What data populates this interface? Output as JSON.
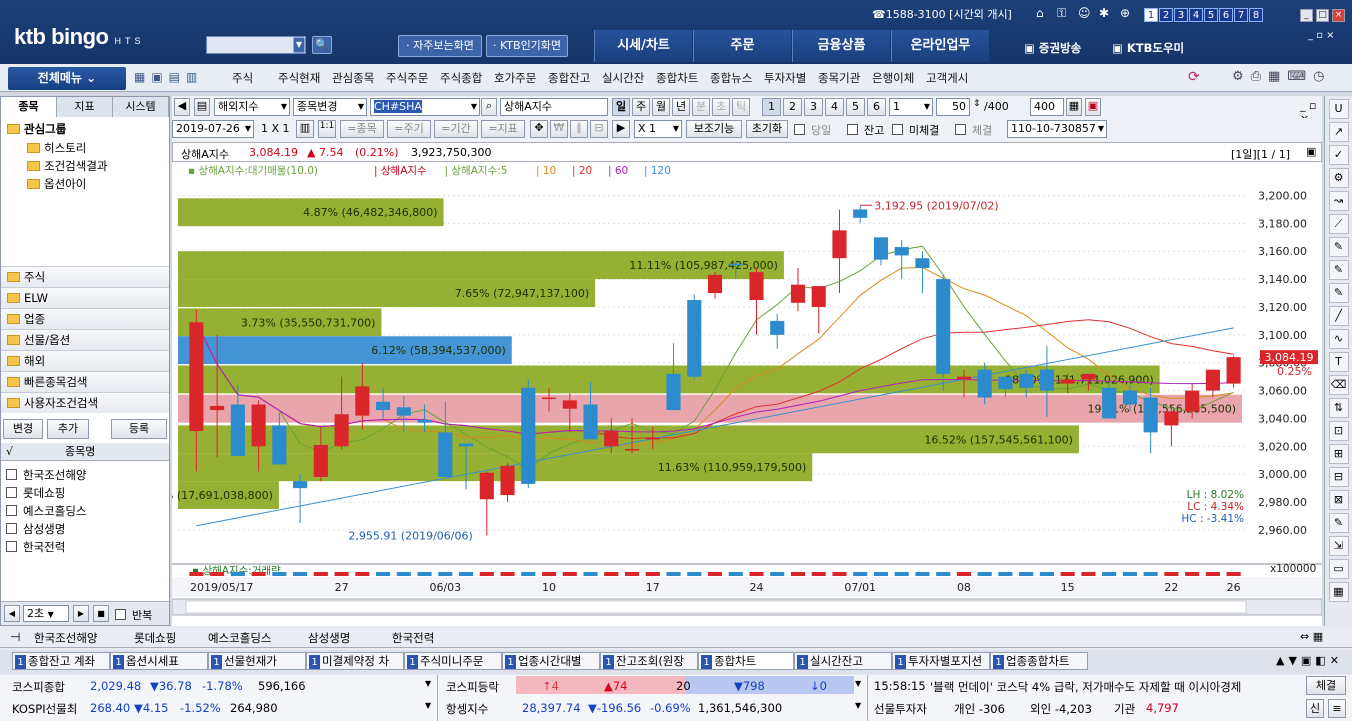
{
  "top": {
    "logo": "ktb bingo",
    "logo_sub": "HTS",
    "phone": "☎1588-3100",
    "status": "[시간외 개시]",
    "num_tabs": [
      "1",
      "2",
      "3",
      "4",
      "5",
      "6",
      "7",
      "8"
    ],
    "quick": [
      "자주보는화면",
      "KTB인기화면"
    ],
    "tabs": [
      "시세/차트",
      "주문",
      "금융상품",
      "온라인업무"
    ],
    "broadcast": "증권방송",
    "help": "KTB도우미"
  },
  "menu": {
    "all": "전체메뉴",
    "items": [
      "주식",
      "주식현재",
      "관심종목",
      "주식주문",
      "주식종합",
      "호가주문",
      "종합잔고",
      "실시간잔",
      "종합차트",
      "종합뉴스",
      "투자자별",
      "종목기관",
      "은행이체",
      "고객게시"
    ]
  },
  "left": {
    "tabs": [
      "종목",
      "지표",
      "시스템"
    ],
    "group": "관심그룹",
    "tree": [
      "히스토리",
      "조건검색결과",
      "옵션아이"
    ],
    "cats": [
      "주식",
      "ELW",
      "업종",
      "선물/옵션",
      "해외",
      "빠른종목검색",
      "사용자조건검색"
    ],
    "buttons": [
      "변경",
      "추가",
      "등록"
    ],
    "col": "종목명",
    "check_head": "√",
    "stocks": [
      "한국조선해양",
      "롯데쇼핑",
      "예스코홀딩스",
      "삼성생명",
      "한국전력"
    ],
    "interval": "2초",
    "repeat": "반복"
  },
  "toolbar": {
    "market": "해외지수",
    "change": "종목변경",
    "code": "CH#SHA",
    "name": "상해A지수",
    "periods": [
      "일",
      "주",
      "월",
      "년",
      "분",
      "초",
      "틱"
    ],
    "nums": [
      "1",
      "2",
      "3",
      "4",
      "5",
      "6"
    ],
    "n1": "1",
    "count": "50",
    "total": "/400",
    "total2": "400",
    "date": "2019-07-26",
    "scale": "1 X 1",
    "btns": [
      "=종목",
      "=주기",
      "=기간",
      "=지표"
    ],
    "mult": "X  1",
    "aux": "보조기능",
    "init": "초기화",
    "checks": [
      "당일",
      "잔고",
      "미체결",
      "체결"
    ],
    "account": "110-10-730857"
  },
  "chart_info": {
    "name": "상해A지수",
    "price": "3,084.19",
    "change": "▲ 7.54",
    "rate": "(0.21%)",
    "volume": "3,923,750,300",
    "page": "[1일][1 / 1]",
    "legend": [
      "상해A지수:대기매물(10.0)",
      "상해A지수",
      "상해A지수:5",
      "10",
      "20",
      "60",
      "120"
    ],
    "legend_colors": [
      "#6aa33a",
      "#d0021b",
      "#6aa33a",
      "#d88a1c",
      "#e03030",
      "#b020c0",
      "#3a8fd0"
    ],
    "vol_legend": "상해A지수:거래량",
    "vol_unit": "x100000"
  },
  "chart_data": {
    "type": "candlestick",
    "x": [
      "2019/05/17",
      "27",
      "06/03",
      "10",
      "17",
      "24",
      "07/01",
      "08",
      "15",
      "22",
      "26"
    ],
    "y_ticks": [
      3200,
      3180,
      3160,
      3140,
      3120,
      3100,
      3080,
      3060,
      3040,
      3020,
      3000,
      2980,
      2960
    ],
    "ylim": [
      2942,
      3214
    ],
    "ohlc": [
      [
        3031,
        3118,
        3002,
        3109
      ],
      [
        3046,
        3100,
        3012,
        3049
      ],
      [
        3050,
        3064,
        3016,
        3013
      ],
      [
        3020,
        3053,
        3002,
        3050
      ],
      [
        3035,
        3044,
        3027,
        3007
      ],
      [
        2995,
        3000,
        2965,
        2990
      ],
      [
        2998,
        3034,
        2995,
        3021
      ],
      [
        3020,
        3070,
        3018,
        3043
      ],
      [
        3042,
        3080,
        3032,
        3063
      ],
      [
        3052,
        3062,
        3040,
        3046
      ],
      [
        3048,
        3056,
        3030,
        3042
      ],
      [
        3039,
        3050,
        3030,
        3037
      ],
      [
        3030,
        3052,
        3024,
        2998
      ],
      [
        3022,
        3021,
        2989,
        3020
      ],
      [
        2982,
        3002,
        2956,
        3001
      ],
      [
        2985,
        3008,
        2980,
        3006
      ],
      [
        3062,
        3068,
        2990,
        2993
      ],
      [
        3055,
        3062,
        3045,
        3055
      ],
      [
        3047,
        3058,
        3030,
        3053
      ],
      [
        3050,
        3066,
        3032,
        3025
      ],
      [
        3020,
        3040,
        3015,
        3031
      ],
      [
        3018,
        3040,
        3015,
        3018
      ],
      [
        3026,
        3034,
        3018,
        3026
      ],
      [
        3072,
        3094,
        3060,
        3046
      ],
      [
        3125,
        3129,
        3068,
        3070
      ],
      [
        3130,
        3145,
        3126,
        3143
      ],
      [
        3151,
        3152,
        3140,
        3150
      ],
      [
        3125,
        3148,
        3100,
        3145
      ],
      [
        3110,
        3115,
        3090,
        3100
      ],
      [
        3123,
        3148,
        3117,
        3136
      ],
      [
        3120,
        3130,
        3101,
        3135
      ],
      [
        3155,
        3190,
        3130,
        3175
      ],
      [
        3190,
        3193,
        3180,
        3184
      ],
      [
        3170,
        3168,
        3150,
        3154
      ],
      [
        3163,
        3168,
        3140,
        3157
      ],
      [
        3155,
        3160,
        3130,
        3148
      ],
      [
        3140,
        3143,
        3060,
        3072
      ],
      [
        3068,
        3075,
        3055,
        3070
      ],
      [
        3075,
        3080,
        3050,
        3055
      ],
      [
        3070,
        3068,
        3055,
        3061
      ],
      [
        3072,
        3075,
        3055,
        3062
      ],
      [
        3075,
        3092,
        3041,
        3060
      ],
      [
        3065,
        3072,
        3058,
        3068
      ],
      [
        3068,
        3070,
        3060,
        3072
      ],
      [
        3062,
        3066,
        3048,
        3040
      ],
      [
        3060,
        3064,
        3045,
        3050
      ],
      [
        3055,
        3062,
        3015,
        3030
      ],
      [
        3035,
        3050,
        3020,
        3045
      ],
      [
        3045,
        3065,
        3040,
        3060
      ],
      [
        3060,
        3072,
        3055,
        3075
      ],
      [
        3065,
        3085,
        3062,
        3084
      ]
    ],
    "supply_bars": [
      {
        "label": "4.87% (46,482,346,800)",
        "pct": 4.87,
        "range": [
          3178,
          3198
        ]
      },
      {
        "label": "11.11% (105,987,425,000)",
        "pct": 11.11,
        "range": [
          3140,
          3160
        ]
      },
      {
        "label": "7.65% (72,947,137,100)",
        "pct": 7.65,
        "range": [
          3120,
          3140
        ]
      },
      {
        "label": "3.73% (35,550,731,700)",
        "pct": 3.73,
        "range": [
          3099,
          3119
        ]
      },
      {
        "label": "6.12% (58,394,537,000)",
        "pct": 6.12,
        "range": [
          3079,
          3099
        ]
      },
      {
        "label": "18.00% (171,711,026,900)",
        "pct": 18.0,
        "range": [
          3058,
          3078
        ]
      },
      {
        "label": "19.51% (186,556,285,500)",
        "pct": 19.51,
        "range": [
          3037,
          3057
        ]
      },
      {
        "label": "16.52% (157,545,561,100)",
        "pct": 16.52,
        "range": [
          3015,
          3035
        ]
      },
      {
        "label": "11.63% (110,959,179,500)",
        "pct": 11.63,
        "range": [
          2995,
          3015
        ]
      },
      {
        "label": "1.85% (17,691,038,800)",
        "pct": 1.85,
        "range": [
          2975,
          2995
        ]
      }
    ],
    "high_note": "3,192.95 (2019/07/02)",
    "low_note": "2,955.91 (2019/06/06)",
    "last_price": "3,084.19",
    "last_rate": "0.25%",
    "lh": "LH :  8.02%",
    "lc": "LC :  4.34%",
    "hc": "HC : -3.41%"
  },
  "bottom": {
    "stocks": [
      "한국조선해양",
      "롯데쇼핑",
      "예스코홀딩스",
      "삼성생명",
      "한국전력"
    ],
    "tasks": [
      "종합잔고 계좌",
      "옵션시세표",
      "선물현재가",
      "미결제약정 차",
      "주식미니주문",
      "업종시간대별",
      "잔고조회(원장",
      "종합차트",
      "실시간잔고",
      "투자자별포지션",
      "업종종합차트"
    ],
    "t1": [
      {
        "k": "코스피종합",
        "v": "2,029.48",
        "c": "▼36.78",
        "r": "-1.78%",
        "vol": "596,166"
      },
      {
        "k": "KOSPI선물최",
        "v": "268.40",
        "c": "▼4.15",
        "r": "-1.52%",
        "vol": "264,980"
      }
    ],
    "t2": [
      {
        "k": "코스피등락",
        "a": "↑4",
        "b": "▲74",
        "c": "20",
        "d": "▼798",
        "e": "↓0"
      },
      {
        "k": "항셍지수",
        "v": "28,397.74",
        "c": "▼-196.56",
        "r": "-0.69%",
        "vol": "1,361,546,300"
      }
    ],
    "news_time": "15:58:15",
    "news": "'블랙 먼데이' 코스닥 4% 급락, 저가매수도 자제할 때 이시아경제",
    "news_btn": "체결",
    "inv": "선물투자자",
    "inv1": "개인 -306",
    "inv2": "외인 -4,203",
    "inv3": "기관",
    "inv3v": "4,797",
    "sin": "신"
  }
}
